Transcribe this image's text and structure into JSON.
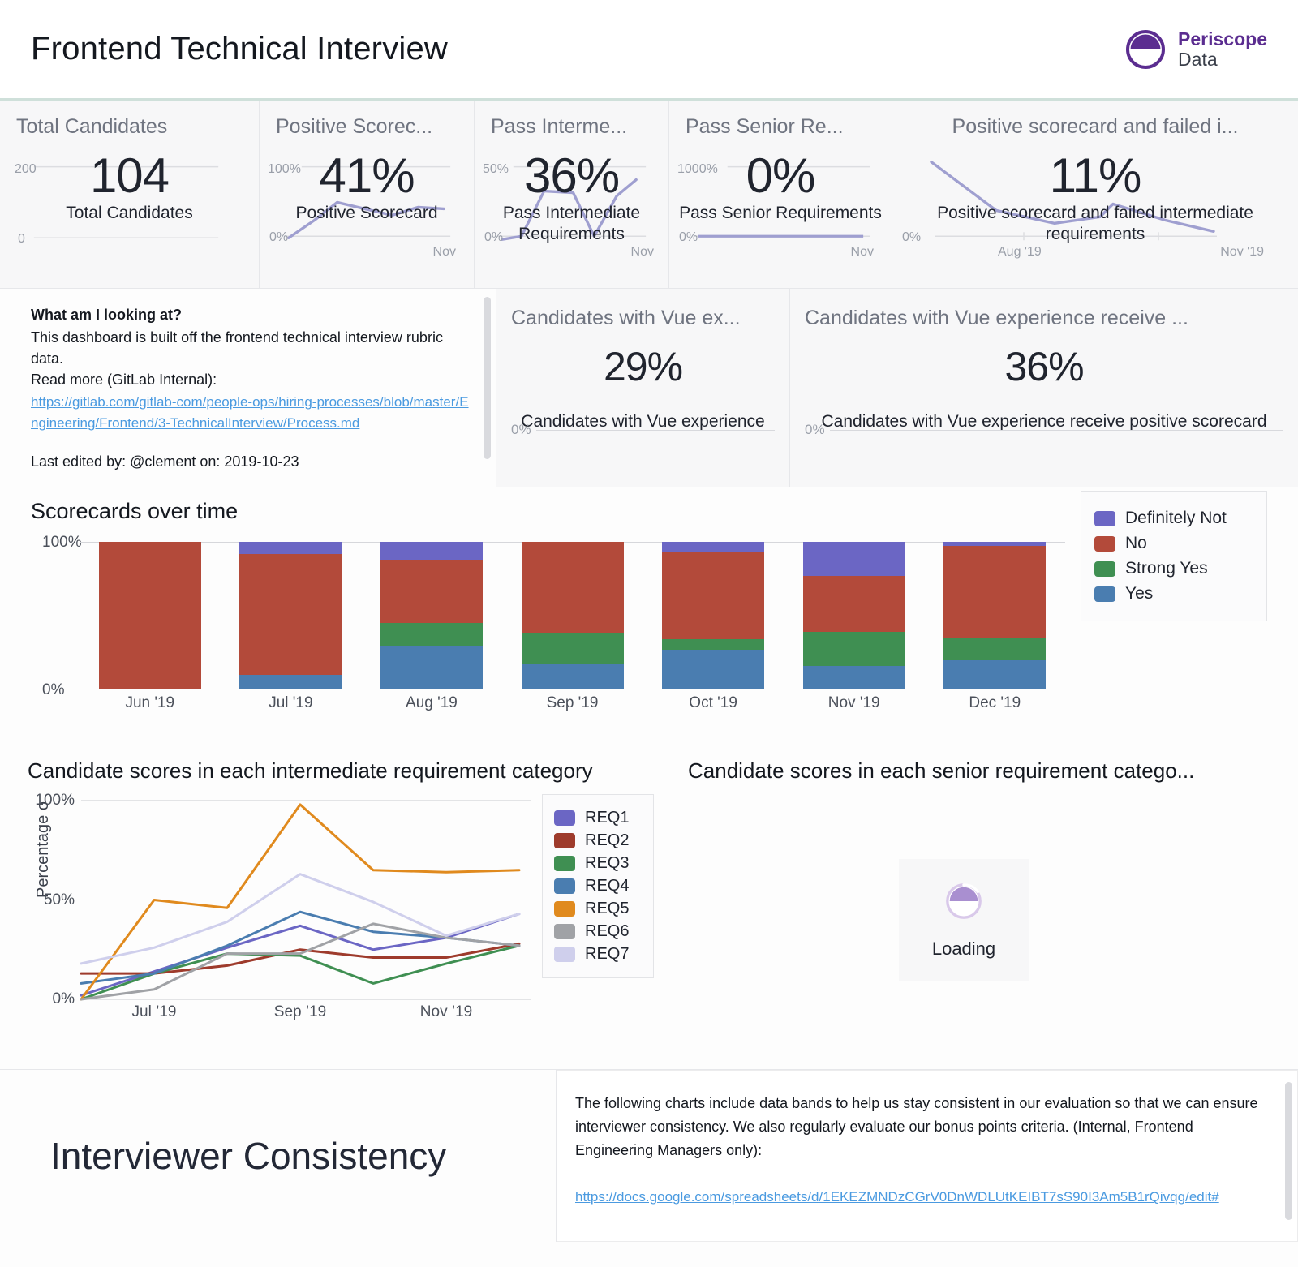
{
  "header": {
    "title": "Frontend Technical Interview",
    "brand_top": "Periscope",
    "brand_bottom": "Data",
    "accent_color": "#cfe0da",
    "brand_color": "#5b2d90"
  },
  "kpis": [
    {
      "title": "Total Candidates",
      "value": "104",
      "subtitle": "Total Candidates",
      "axis_top": "200",
      "axis_bottom": "0",
      "axis_right": "",
      "axis_right2": "",
      "has_spark": false
    },
    {
      "title": "Positive Scorec...",
      "value": "41%",
      "subtitle": "Positive Scorecard",
      "axis_top": "100%",
      "axis_bottom": "0%",
      "axis_right": "Nov",
      "axis_right2": "",
      "has_spark": true
    },
    {
      "title": "Pass Interme...",
      "value": "36%",
      "subtitle": "Pass Intermediate Requirements",
      "axis_top": "50%",
      "axis_bottom": "0%",
      "axis_right": "Nov",
      "axis_right2": "",
      "has_spark": true
    },
    {
      "title": "Pass Senior Re...",
      "value": "0%",
      "subtitle": "Pass Senior Requirements",
      "axis_top": "1000%",
      "axis_bottom": "0%",
      "axis_right": "Nov",
      "axis_right2": "",
      "has_spark": true
    },
    {
      "title": "Positive scorecard and failed i...",
      "value": "11%",
      "subtitle": "Positive scorecard and failed intermediate requirements",
      "axis_top": "",
      "axis_bottom": "0%",
      "axis_right": "Aug '19",
      "axis_right2": "Nov '19",
      "has_spark": true
    }
  ],
  "info": {
    "heading": "What am I looking at?",
    "paragraph": "This dashboard is built off the frontend technical interview rubric data.",
    "read_more": "Read more (GitLab Internal):",
    "link": "https://gitlab.com/gitlab-com/people-ops/hiring-processes/blob/master/Engineering/Frontend/3-TechnicalInterview/Process.md",
    "footer": "Last edited by: @clement on: 2019-10-23"
  },
  "vue_tiles": [
    {
      "title": "Candidates with Vue ex...",
      "value": "29%",
      "subtitle": "Candidates with Vue experience",
      "axis_bottom": "0%"
    },
    {
      "title": "Candidates with Vue experience receive ...",
      "value": "36%",
      "subtitle": "Candidates with Vue experience receive positive scorecard",
      "axis_bottom": "0%"
    }
  ],
  "scorecards_panel": {
    "title": "Scorecards over time"
  },
  "line_panel": {
    "title": "Candidate scores in each intermediate requirement category",
    "ylabel": "Percentage o"
  },
  "senior_panel": {
    "title": "Candidate scores in each senior requirement catego...",
    "loading_label": "Loading"
  },
  "footer": {
    "heading": "Interviewer Consistency",
    "paragraph": "The following charts include data bands to help us stay consistent in our evaluation so that we can ensure interviewer consistency. We also regularly evaluate our bonus points criteria. (Internal, Frontend Engineering Managers only):",
    "link": "https://docs.google.com/spreadsheets/d/1EKEZMNDzCGrV0DnWDLUtKEIBT7sS90I3Am5B1rQivqg/edit#"
  },
  "chart_data": [
    {
      "type": "bar",
      "id": "scorecards-over-time",
      "title": "Scorecards over time",
      "stacked": true,
      "stack_mode": "percent",
      "xlabel": "",
      "ylabel": "",
      "ylim": [
        0,
        100
      ],
      "yticks": [
        "0%",
        "100%"
      ],
      "grid": true,
      "legend_position": "right",
      "categories": [
        "Jun '19",
        "Jul '19",
        "Aug '19",
        "Sep '19",
        "Oct '19",
        "Nov '19",
        "Dec '19"
      ],
      "series": [
        {
          "name": "Yes",
          "color": "#4A7DB0",
          "values": [
            0,
            10,
            29,
            17,
            27,
            16,
            20
          ]
        },
        {
          "name": "Strong Yes",
          "color": "#3F8F52",
          "values": [
            0,
            0,
            16,
            21,
            7,
            23,
            15
          ]
        },
        {
          "name": "No",
          "color": "#B34A3A",
          "values": [
            100,
            82,
            43,
            62,
            59,
            38,
            62
          ]
        },
        {
          "name": "Definitely Not",
          "color": "#6B66C4",
          "values": [
            0,
            8,
            12,
            0,
            7,
            23,
            3
          ]
        }
      ]
    },
    {
      "type": "line",
      "id": "intermediate-requirements",
      "title": "Candidate scores in each intermediate requirement category",
      "xlabel": "",
      "ylabel": "Percentage o",
      "ylim": [
        0,
        100
      ],
      "yticks": [
        "0%",
        "50%",
        "100%"
      ],
      "grid": true,
      "legend_position": "right",
      "x": [
        "Jun '19",
        "Jul '19",
        "Aug '19",
        "Sep '19",
        "Oct '19",
        "Nov '19",
        "Dec '19"
      ],
      "xticks": [
        "Jul '19",
        "Sep '19",
        "Nov '19"
      ],
      "series": [
        {
          "name": "REQ1",
          "color": "#6B66C4",
          "values": [
            2,
            14,
            26,
            37,
            25,
            31,
            43
          ]
        },
        {
          "name": "REQ2",
          "color": "#9E3B2C",
          "values": [
            13,
            13,
            17,
            25,
            21,
            21,
            28
          ]
        },
        {
          "name": "REQ3",
          "color": "#3F8F52",
          "values": [
            0,
            13,
            23,
            22,
            8,
            18,
            27
          ]
        },
        {
          "name": "REQ4",
          "color": "#4A7DB0",
          "values": [
            8,
            13,
            27,
            44,
            34,
            31,
            27
          ]
        },
        {
          "name": "REQ5",
          "color": "#E08A1E",
          "values": [
            0,
            50,
            46,
            98,
            65,
            64,
            65
          ]
        },
        {
          "name": "REQ6",
          "color": "#A0A2A6",
          "values": [
            0,
            5,
            23,
            23,
            38,
            31,
            27
          ]
        },
        {
          "name": "REQ7",
          "color": "#CFCFEC",
          "values": [
            18,
            26,
            39,
            63,
            49,
            32,
            43
          ]
        }
      ]
    }
  ]
}
